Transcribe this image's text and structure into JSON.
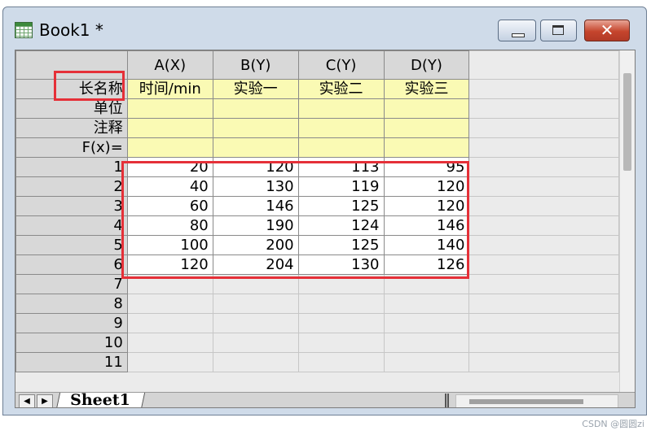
{
  "window": {
    "title": "Book1 *",
    "icon": "worksheet-icon",
    "buttons": {
      "minimize": "minimize-icon",
      "maximize": "maximize-icon",
      "close": "✕"
    }
  },
  "columns": [
    "A(X)",
    "B(Y)",
    "C(Y)",
    "D(Y)"
  ],
  "meta_rows": [
    {
      "label": "长名称",
      "values": [
        "时间/min",
        "实验一",
        "实验二",
        "实验三"
      ]
    },
    {
      "label": "单位",
      "values": [
        "",
        "",
        "",
        ""
      ]
    },
    {
      "label": "注释",
      "values": [
        "",
        "",
        "",
        ""
      ]
    },
    {
      "label": "F(x)=",
      "values": [
        "",
        "",
        "",
        ""
      ]
    }
  ],
  "data_rows": [
    {
      "label": "1",
      "values": [
        "20",
        "120",
        "113",
        "95"
      ]
    },
    {
      "label": "2",
      "values": [
        "40",
        "130",
        "119",
        "120"
      ]
    },
    {
      "label": "3",
      "values": [
        "60",
        "146",
        "125",
        "120"
      ]
    },
    {
      "label": "4",
      "values": [
        "80",
        "190",
        "124",
        "146"
      ]
    },
    {
      "label": "5",
      "values": [
        "100",
        "200",
        "125",
        "140"
      ]
    },
    {
      "label": "6",
      "values": [
        "120",
        "204",
        "130",
        "126"
      ]
    }
  ],
  "empty_rows": [
    "7",
    "8",
    "9",
    "10",
    "11"
  ],
  "sheet_tab": "Sheet1",
  "nav": {
    "prev": "◀",
    "next": "▶"
  },
  "highlight_color": "#e53038",
  "watermark": "CSDN @圆圆zi"
}
